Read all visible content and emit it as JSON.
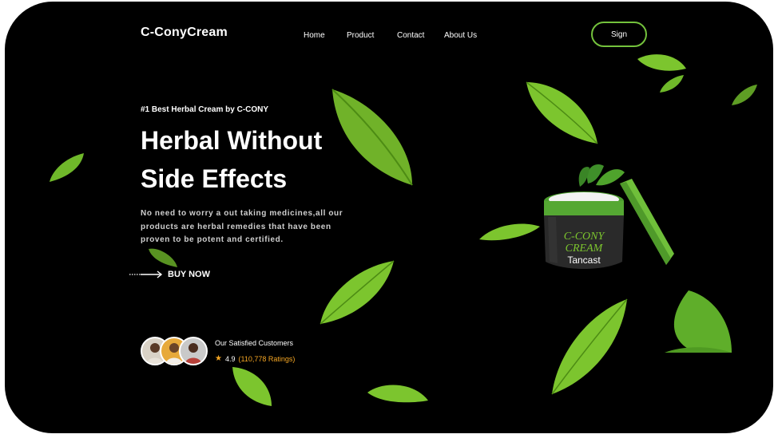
{
  "brand": {
    "logo": "C-ConyCream"
  },
  "nav": {
    "items": [
      "Home",
      "Product",
      "Contact",
      "About Us"
    ]
  },
  "header": {
    "sign_label": "Sign"
  },
  "hero": {
    "tagline": "#1 Best Herbal Cream by C-CONY",
    "headline": "Herbal Without Side Effects",
    "description": "No need to worry a out taking medicines,all our products are herbal remedies that have been proven to be potent and certified.",
    "cta_label": "BUY NOW"
  },
  "customers": {
    "title": "Our Satisfied Customers",
    "rating": "4.9",
    "ratings_count": "(110,778 Ratings)"
  },
  "product": {
    "jar_text_line1": "C-CONY",
    "jar_text_line2": "CREAM",
    "jar_brand": "Tancast"
  },
  "colors": {
    "accent": "#74c23c",
    "background": "#000000",
    "star": "#f5a623",
    "leaf": "#7cc52e"
  }
}
